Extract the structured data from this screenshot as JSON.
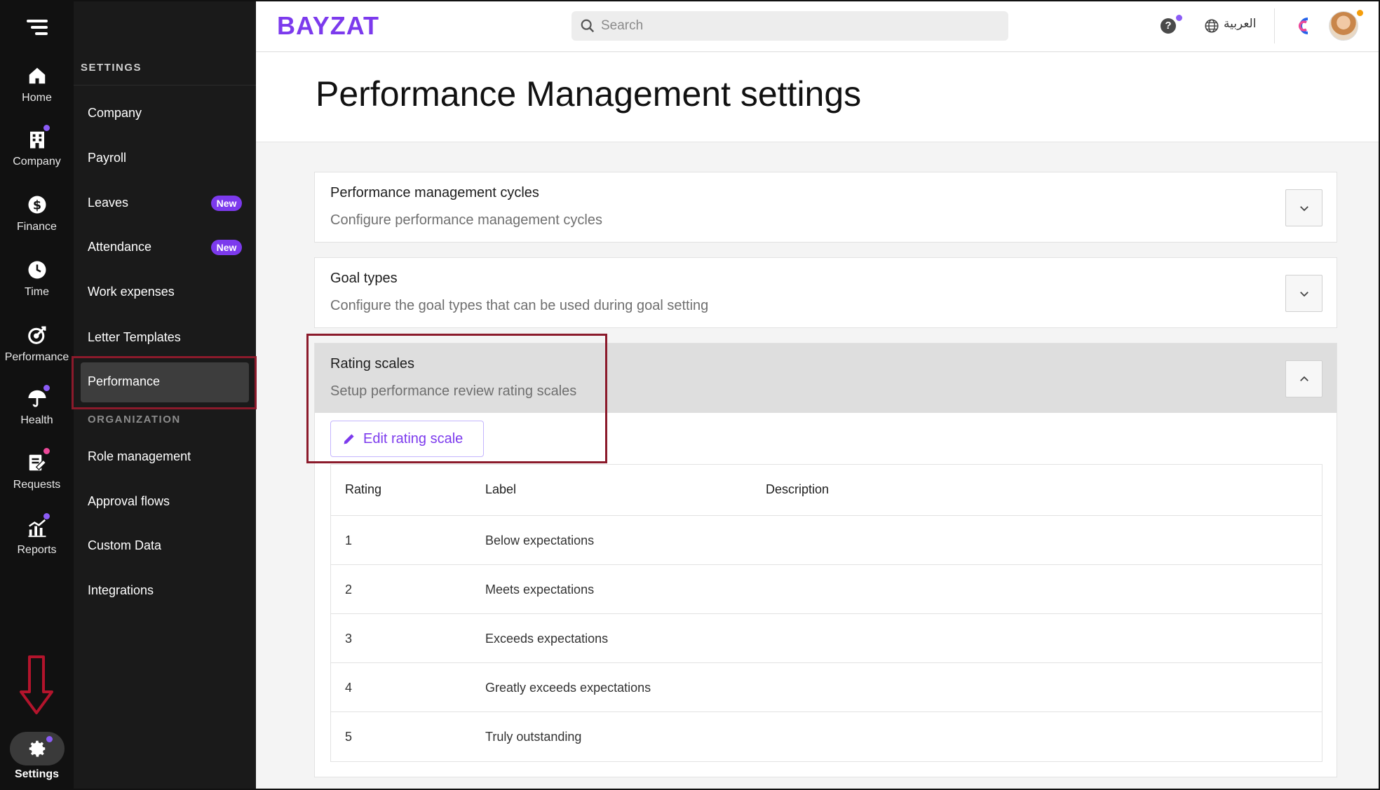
{
  "rail": {
    "items": [
      {
        "label": "Home",
        "icon": "home-icon"
      },
      {
        "label": "Company",
        "icon": "building-icon"
      },
      {
        "label": "Finance",
        "icon": "dollar-icon"
      },
      {
        "label": "Time",
        "icon": "clock-icon"
      },
      {
        "label": "Performance",
        "icon": "target-icon"
      },
      {
        "label": "Health",
        "icon": "umbrella-icon"
      },
      {
        "label": "Requests",
        "icon": "document-edit-icon"
      },
      {
        "label": "Reports",
        "icon": "chart-icon"
      }
    ],
    "settings_label": "Settings"
  },
  "sidebar": {
    "title": "SETTINGS",
    "items": [
      {
        "label": "Company"
      },
      {
        "label": "Payroll"
      },
      {
        "label": "Leaves",
        "badge": "New"
      },
      {
        "label": "Attendance",
        "badge": "New"
      },
      {
        "label": "Work expenses"
      },
      {
        "label": "Letter Templates"
      },
      {
        "label": "Performance"
      }
    ],
    "section": "ORGANIZATION",
    "org_items": [
      {
        "label": "Role management"
      },
      {
        "label": "Approval flows"
      },
      {
        "label": "Custom Data"
      },
      {
        "label": "Integrations"
      }
    ]
  },
  "header": {
    "logo": "BAYZAT",
    "search_placeholder": "Search",
    "help": "?",
    "language": "العربية"
  },
  "page": {
    "title": "Performance Management settings"
  },
  "cards": [
    {
      "title": "Performance management cycles",
      "subtitle": "Configure performance management cycles"
    },
    {
      "title": "Goal types",
      "subtitle": "Configure the goal types that can be used during goal setting"
    },
    {
      "title": "Rating scales",
      "subtitle": "Setup performance review rating scales"
    }
  ],
  "rating": {
    "edit_label": "Edit rating scale",
    "columns": [
      "Rating",
      "Label",
      "Description"
    ],
    "rows": [
      {
        "rating": "1",
        "label": "Below expectations"
      },
      {
        "rating": "2",
        "label": "Meets expectations"
      },
      {
        "rating": "3",
        "label": "Exceeds expectations"
      },
      {
        "rating": "4",
        "label": "Greatly exceeds expectations"
      },
      {
        "rating": "5",
        "label": "Truly outstanding"
      }
    ]
  },
  "colors": {
    "brand": "#7c3aed",
    "highlight": "#8b1a2b",
    "sidebar_bg": "#1a1a1a",
    "rail_bg": "#111111"
  }
}
